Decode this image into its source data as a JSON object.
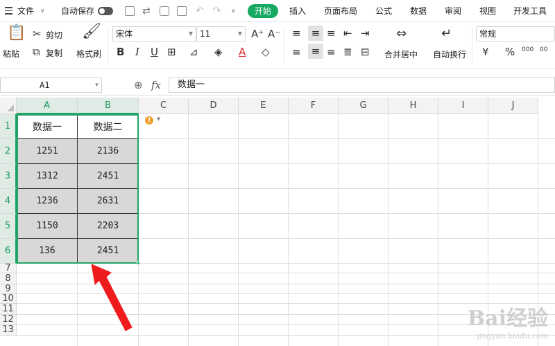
{
  "menu": {
    "file": "文件",
    "autosave": "自动保存",
    "tabs": [
      "开始",
      "插入",
      "页面布局",
      "公式",
      "数据",
      "审阅",
      "视图",
      "开发工具"
    ]
  },
  "ribbon": {
    "paste": "粘贴",
    "cut": "剪切",
    "copy": "复制",
    "format_painter": "格式刷",
    "font_name": "宋体",
    "font_size": "11",
    "bold": "B",
    "italic": "I",
    "underline": "U",
    "font_color_letter": "A",
    "merge_center": "合并居中",
    "wrap_text": "自动换行",
    "number_format": "常规",
    "currency": "¥",
    "percent": "%",
    "inc_decimal": "000",
    "dec_decimal": "00"
  },
  "formula_bar": {
    "cell_ref": "A1",
    "fx": "fx",
    "content": "数据一"
  },
  "grid": {
    "columns": [
      "A",
      "B",
      "C",
      "D",
      "E",
      "F",
      "G",
      "H",
      "I",
      "J"
    ],
    "rows": [
      "1",
      "2",
      "3",
      "4",
      "5",
      "6",
      "7",
      "8",
      "9",
      "10",
      "11",
      "12",
      "13"
    ],
    "cells": [
      [
        "数据一",
        "数据二"
      ],
      [
        "1251",
        "2136"
      ],
      [
        "1312",
        "2451"
      ],
      [
        "1236",
        "2631"
      ],
      [
        "1150",
        "2203"
      ],
      [
        "136",
        "2451"
      ]
    ]
  },
  "colors": {
    "accent": "#17a862",
    "selection": "#21a366",
    "arrow": "#ee1c1c",
    "data_fill": "#d8d8d8"
  },
  "watermark": {
    "brand": "Bai经验",
    "url": "jingyan.baidu.com"
  }
}
